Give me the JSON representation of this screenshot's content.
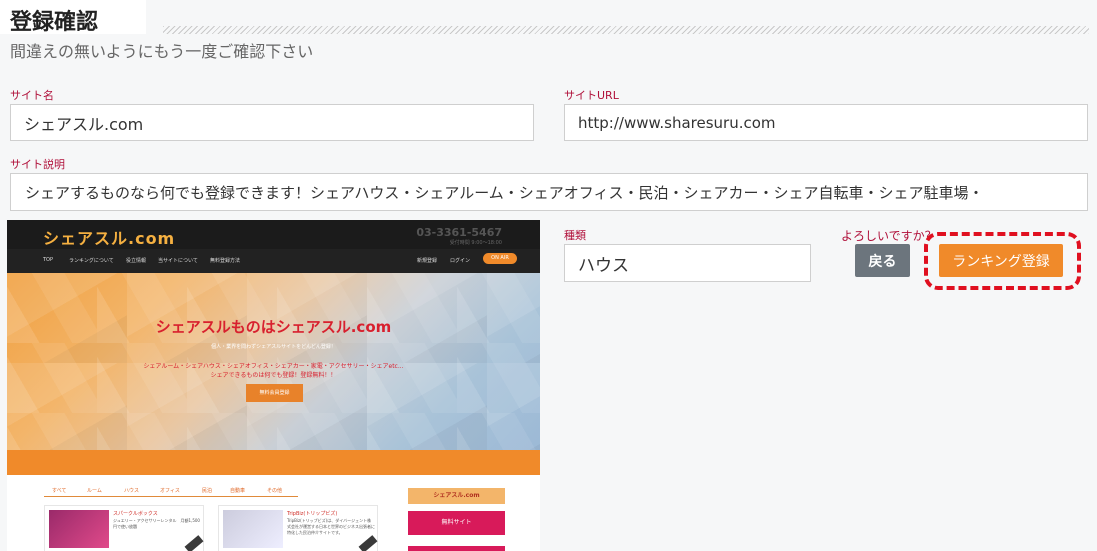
{
  "header": {
    "title": "登録確認",
    "subtitle": "間違えの無いようにもう一度ご確認下さい"
  },
  "form": {
    "site_name_label": "サイト名",
    "site_name_value": "シェアスル.com",
    "site_url_label": "サイトURL",
    "site_url_value": "http://www.sharesuru.com",
    "site_desc_label": "サイト説明",
    "site_desc_value": "シェアするものなら何でも登録できます！シェアハウス・シェアルーム・シェアオフィス・民泊・シェアカー・シェア自転車・シェア駐車場・",
    "kind_label": "種類",
    "kind_value": "ハウス"
  },
  "actions": {
    "confirm_question": "よろしいですか？",
    "back_label": "戻る",
    "register_label": "ランキング登録"
  },
  "thumbnail": {
    "logo": "シェアスル.com",
    "phone": "03-3361-5467",
    "hours": "受付時間 9:00～18:00",
    "nav": [
      "TOP",
      "ランキングについて",
      "役立情報",
      "当サイトについて",
      "無料登録方法"
    ],
    "nav_right": [
      "新規登録",
      "ログイン"
    ],
    "nav_pill": "ON AIR",
    "hero_title": "シェアスルものはシェアスル.com",
    "hero_sub": "個人・業界を問わずシェアスルサイトをどんどん登録！",
    "hero_line1": "シェアルーム・シェアハウス・シェアオフィス・シェアカー・家電・アクセサリー・シェアetc...",
    "hero_line2": "シェアできるものは何でも登録！登録無料！！",
    "hero_button": "無料会員登録",
    "tabs": [
      "すべて",
      "ルーム",
      "ハウス",
      "オフィス",
      "民泊",
      "自動車",
      "その他"
    ],
    "card1_title": "スパークルボックス",
    "card1_text": "ジュエリー・アクセサリーレンタル　月額1,500円で使い放題",
    "card2_title": "TripBiz(トリップビズ)",
    "card2_text": "TripBiz(トリップビズ)は、ダイバージェント株式会社が運営する日本と世界のビジネス出張者に特化した民泊仲介サイトです。",
    "side_logo": "シェアスル.com",
    "side_button": "無料サイト"
  }
}
